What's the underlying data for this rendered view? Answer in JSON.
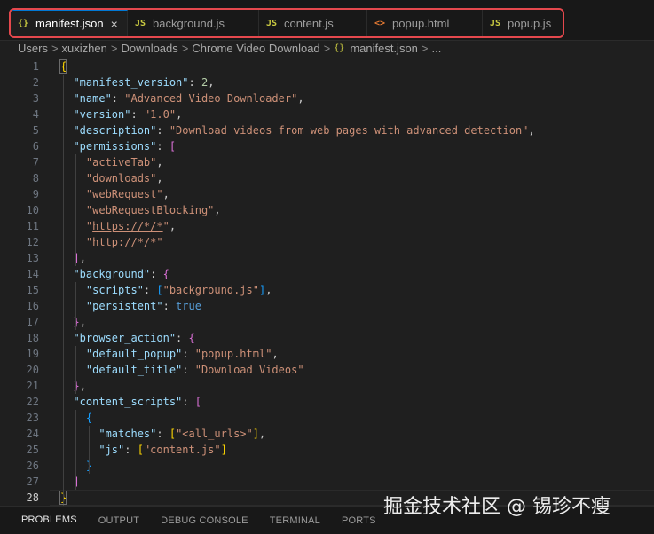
{
  "tabs": [
    {
      "icon": "{}",
      "label": "manifest.json",
      "active": true,
      "close": "×"
    },
    {
      "icon": "JS",
      "label": "background.js"
    },
    {
      "icon": "JS",
      "label": "content.js"
    },
    {
      "icon": "<>",
      "label": "popup.html"
    },
    {
      "icon": "JS",
      "label": "popup.js"
    }
  ],
  "breadcrumb": {
    "parts": [
      "Users",
      "xuxizhen",
      "Downloads",
      "Chrome Video Download"
    ],
    "file_icon": "{}",
    "file": "manifest.json",
    "tail": "...",
    "sep": ">"
  },
  "editor": {
    "current_line": 28,
    "lines": [
      [
        [
          "y",
          "{"
        ]
      ],
      [
        [
          "k",
          "  \"manifest_version\""
        ],
        [
          "p",
          ": "
        ],
        [
          "n",
          "2"
        ],
        [
          "p",
          ","
        ]
      ],
      [
        [
          "k",
          "  \"name\""
        ],
        [
          "p",
          ": "
        ],
        [
          "s",
          "\"Advanced Video Downloader\""
        ],
        [
          "p",
          ","
        ]
      ],
      [
        [
          "k",
          "  \"version\""
        ],
        [
          "p",
          ": "
        ],
        [
          "s",
          "\"1.0\""
        ],
        [
          "p",
          ","
        ]
      ],
      [
        [
          "k",
          "  \"description\""
        ],
        [
          "p",
          ": "
        ],
        [
          "s",
          "\"Download videos from web pages with advanced detection\""
        ],
        [
          "p",
          ","
        ]
      ],
      [
        [
          "k",
          "  \"permissions\""
        ],
        [
          "p",
          ": "
        ],
        [
          "m",
          "["
        ]
      ],
      [
        [
          "s",
          "    \"activeTab\""
        ],
        [
          "p",
          ","
        ]
      ],
      [
        [
          "s",
          "    \"downloads\""
        ],
        [
          "p",
          ","
        ]
      ],
      [
        [
          "s",
          "    \"webRequest\""
        ],
        [
          "p",
          ","
        ]
      ],
      [
        [
          "s",
          "    \"webRequestBlocking\""
        ],
        [
          "p",
          ","
        ]
      ],
      [
        [
          "s",
          "    \""
        ],
        [
          "su",
          "https://*/*"
        ],
        [
          "s",
          "\""
        ],
        [
          "p",
          ","
        ]
      ],
      [
        [
          "s",
          "    \""
        ],
        [
          "su",
          "http://*/*"
        ],
        [
          "s",
          "\""
        ]
      ],
      [
        [
          "m",
          "  ]"
        ],
        [
          "p",
          ","
        ]
      ],
      [
        [
          "k",
          "  \"background\""
        ],
        [
          "p",
          ": "
        ],
        [
          "m",
          "{"
        ]
      ],
      [
        [
          "k",
          "    \"scripts\""
        ],
        [
          "p",
          ": "
        ],
        [
          "c",
          "["
        ],
        [
          "s",
          "\"background.js\""
        ],
        [
          "c",
          "]"
        ],
        [
          "p",
          ","
        ]
      ],
      [
        [
          "k",
          "    \"persistent\""
        ],
        [
          "p",
          ": "
        ],
        [
          "b",
          "true"
        ]
      ],
      [
        [
          "m",
          "  }"
        ],
        [
          "p",
          ","
        ]
      ],
      [
        [
          "k",
          "  \"browser_action\""
        ],
        [
          "p",
          ": "
        ],
        [
          "m",
          "{"
        ]
      ],
      [
        [
          "k",
          "    \"default_popup\""
        ],
        [
          "p",
          ": "
        ],
        [
          "s",
          "\"popup.html\""
        ],
        [
          "p",
          ","
        ]
      ],
      [
        [
          "k",
          "    \"default_title\""
        ],
        [
          "p",
          ": "
        ],
        [
          "s",
          "\"Download Videos\""
        ]
      ],
      [
        [
          "m",
          "  }"
        ],
        [
          "p",
          ","
        ]
      ],
      [
        [
          "k",
          "  \"content_scripts\""
        ],
        [
          "p",
          ": "
        ],
        [
          "m",
          "["
        ]
      ],
      [
        [
          "c",
          "    {"
        ]
      ],
      [
        [
          "k",
          "      \"matches\""
        ],
        [
          "p",
          ": "
        ],
        [
          "y",
          "["
        ],
        [
          "s",
          "\"<all_urls>\""
        ],
        [
          "y",
          "]"
        ],
        [
          "p",
          ","
        ]
      ],
      [
        [
          "k",
          "      \"js\""
        ],
        [
          "p",
          ": "
        ],
        [
          "y",
          "["
        ],
        [
          "s",
          "\"content.js\""
        ],
        [
          "y",
          "]"
        ]
      ],
      [
        [
          "c",
          "    }"
        ]
      ],
      [
        [
          "m",
          "  ]"
        ]
      ],
      [
        [
          "y",
          "}"
        ]
      ]
    ]
  },
  "panel": {
    "tabs": [
      "PROBLEMS",
      "OUTPUT",
      "DEBUG CONSOLE",
      "TERMINAL",
      "PORTS"
    ],
    "active": 0
  },
  "watermark": "掘金技术社区 @ 锡珍不瘦",
  "colors": {
    "highlight_border": "#e5484d",
    "accent": "#0078d4",
    "key": "#9cdcfe",
    "string": "#ce9178",
    "number": "#b5cea8",
    "keyword": "#569cd6"
  }
}
